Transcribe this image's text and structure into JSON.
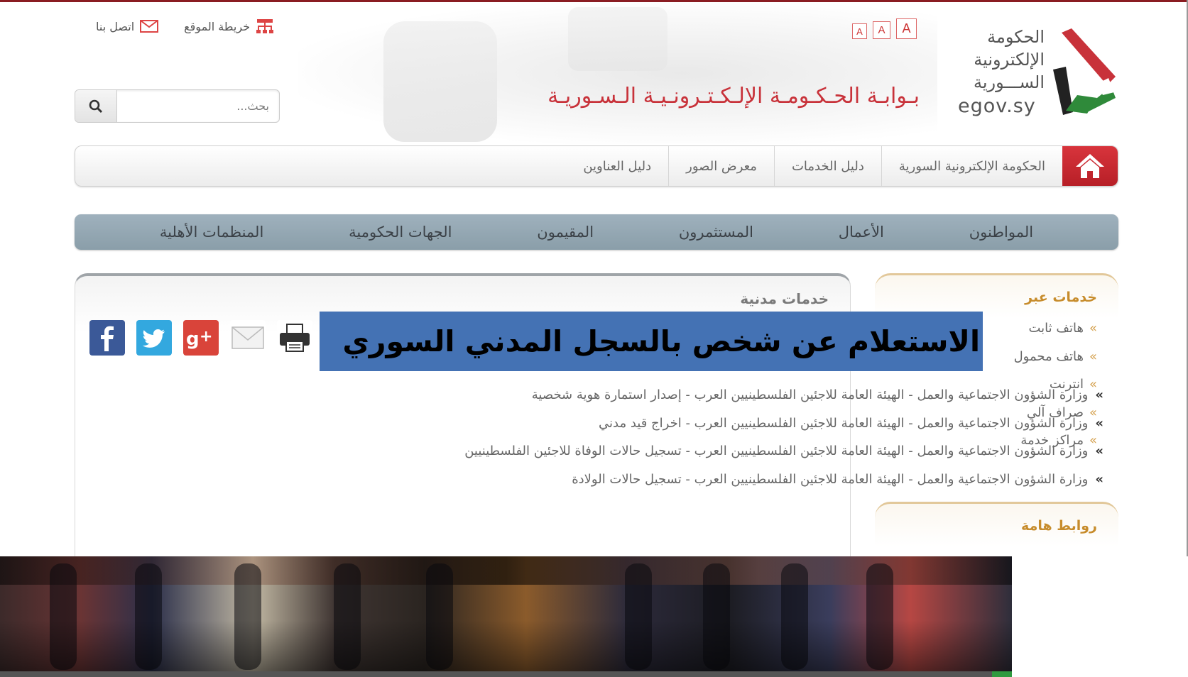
{
  "header": {
    "logo_lines": [
      "الحكومة",
      "الإلكترونية",
      "الســـورية"
    ],
    "logo_domain": "egov.sy",
    "site_title": "بـوابـة الحـكـومـة الإلـكـتـرونـيـة الـسـوريـة",
    "font_size_buttons": [
      "A",
      "A",
      "A"
    ],
    "top_links": {
      "sitemap": "خريطة الموقع",
      "contact": "اتصل بنا"
    },
    "search_placeholder": "بحث..."
  },
  "nav_main": {
    "items": [
      "الحكومة الإلكترونية السورية",
      "دليل الخدمات",
      "معرض الصور",
      "دليل العناوين"
    ]
  },
  "nav_audience": {
    "items": [
      "المواطنون",
      "الأعمال",
      "المستثمرون",
      "المقيمون",
      "الجهات الحكومية",
      "المنظمات الأهلية"
    ]
  },
  "sidebar": {
    "services_title": "خدمات عبر",
    "services_items": [
      "هاتف ثابت",
      "هاتف محمول",
      "انترنت",
      "صراف آلي",
      "مراكز خدمة"
    ],
    "links_title": "روابط هامة"
  },
  "main": {
    "section_title": "خدمات مدنية",
    "banner_text": "الاستعلام عن شخص بالسجل المدني السوري",
    "bullet": "»",
    "services": [
      "وزارة الشؤون الاجتماعية والعمل - الهيئة العامة للاجئين الفلسطينيين العرب - إصدار استمارة هوية شخصية",
      "وزارة الشؤون الاجتماعية والعمل - الهيئة العامة للاجئين الفلسطينيين العرب - اخراج قيد مدني",
      "وزارة الشؤون الاجتماعية والعمل - الهيئة العامة للاجئين الفلسطينيين العرب - تسجيل حالات الوفاة للاجئين الفلسطينيين",
      "وزارة الشؤون الاجتماعية والعمل - الهيئة العامة للاجئين الفلسطينيين العرب - تسجيل حالات الولادة"
    ]
  },
  "colors": {
    "brand_red": "#c8323a",
    "nav_blue_grey": "#9fb1bd",
    "banner_blue": "#4472b4",
    "sidebar_gold": "#c78c2c"
  },
  "icons": [
    "home-icon",
    "search-icon",
    "sitemap-icon",
    "mail-icon",
    "print-icon",
    "email-share-icon",
    "google-plus-icon",
    "twitter-icon",
    "facebook-icon"
  ]
}
